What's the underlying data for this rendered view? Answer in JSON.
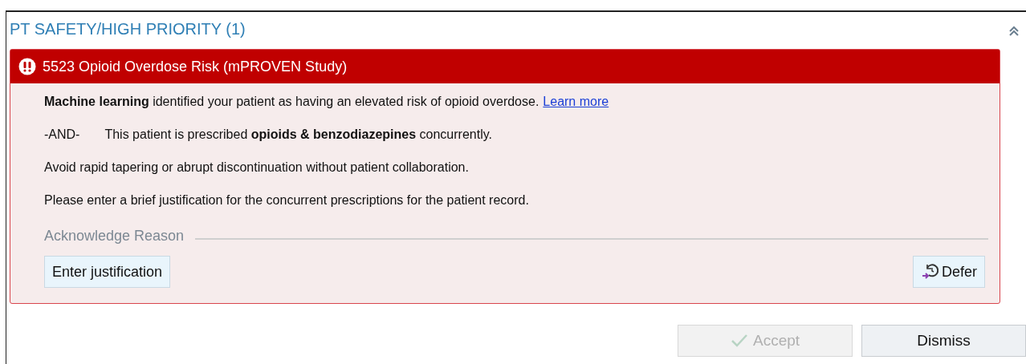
{
  "panel": {
    "title": "PT SAFETY/HIGH PRIORITY (1)",
    "expanded": true
  },
  "alert": {
    "title": "5523 Opioid Overdose Risk (mPROVEN Study)",
    "lines": [
      {
        "text": "**Machine learning** identified your patient as having an elevated risk of opioid overdose.",
        "link": "Learn more"
      },
      {
        "prefix": "-AND-",
        "text": "This patient is prescribed **opioids & benzodiazepines** concurrently."
      },
      {
        "text": "Avoid rapid tapering or abrupt discontinuation without patient collaboration."
      },
      {
        "text": "Please enter a brief justification for the concurrent prescriptions for the patient record."
      }
    ],
    "acknowledge_label": "Acknowledge Reason",
    "buttons": [
      {
        "label": "Enter justification",
        "kind": "plain"
      },
      {
        "label": "Defer",
        "kind": "defer"
      }
    ]
  },
  "footer_buttons": [
    {
      "label": "Accept",
      "kind": "accept",
      "disabled": true
    },
    {
      "label": "Dismiss",
      "kind": "plain",
      "disabled": false
    }
  ]
}
